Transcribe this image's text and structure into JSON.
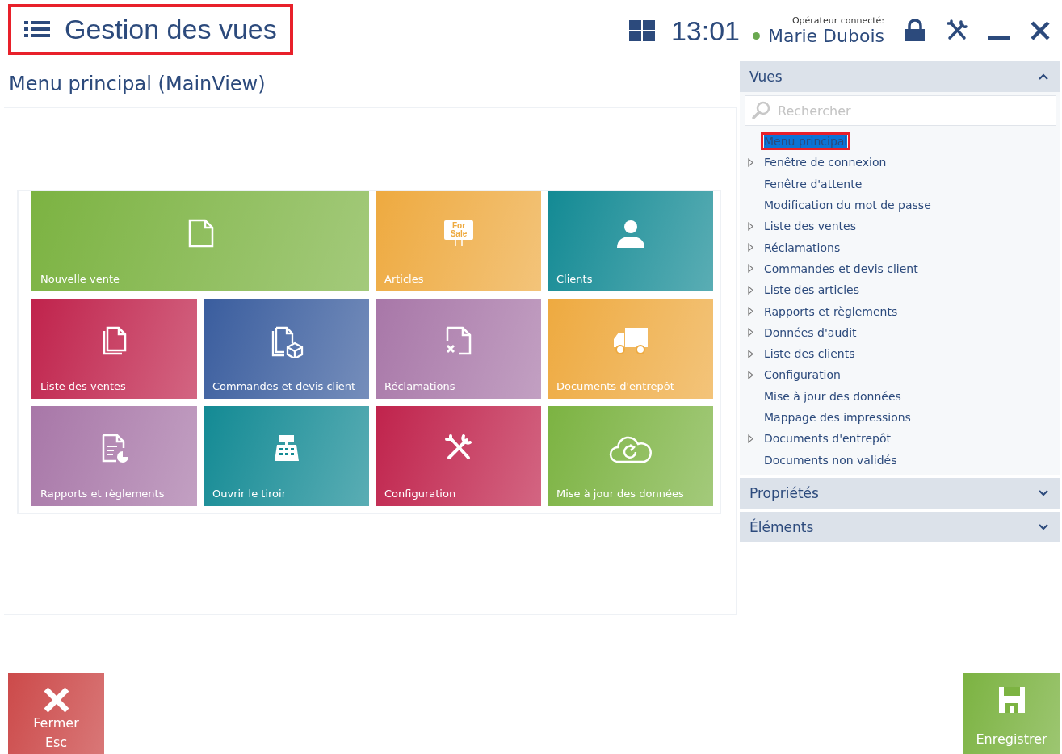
{
  "header": {
    "title": "Gestion des vues",
    "title_highlighted": true,
    "time": "13:01",
    "operator_label": "Opérateur connecté:",
    "operator_name": "Marie Dubois"
  },
  "main": {
    "title": "Menu principal (MainView)",
    "tiles": [
      {
        "label": "Nouvelle vente",
        "kind": "document",
        "color": "#7cb342",
        "wide": true
      },
      {
        "label": "Articles",
        "kind": "sign",
        "color": "#eeaa40",
        "wide": false,
        "sign_text": [
          "For",
          "Sale"
        ]
      },
      {
        "label": "Clients",
        "kind": "person",
        "color": "#138a94",
        "wide": false
      },
      {
        "label": "Liste des ventes",
        "kind": "documents",
        "color": "#c0234c",
        "wide": false
      },
      {
        "label": "Commandes et devis client",
        "kind": "documents-box",
        "color": "#3a5d9e",
        "wide": false
      },
      {
        "label": "Réclamations",
        "kind": "document-x",
        "color": "#a877a8",
        "wide": false
      },
      {
        "label": "Documents d'entrepôt",
        "kind": "truck",
        "color": "#eeaa40",
        "wide": false
      },
      {
        "label": "Rapports et règlements",
        "kind": "report",
        "color": "#a877a8",
        "wide": false
      },
      {
        "label": "Ouvrir le tiroir",
        "kind": "register",
        "color": "#138a94",
        "wide": false
      },
      {
        "label": "Configuration",
        "kind": "tools",
        "color": "#c0234c",
        "wide": false
      },
      {
        "label": "Mise à jour des données",
        "kind": "cloud",
        "color": "#7cb342",
        "wide": false
      }
    ]
  },
  "side": {
    "sections": [
      {
        "title": "Vues",
        "expanded": true,
        "search": {
          "placeholder": "Rechercher"
        },
        "tree": [
          {
            "label": "Menu principal",
            "expandable": false,
            "selected": true,
            "highlighted": true
          },
          {
            "label": "Fenêtre de connexion",
            "expandable": true,
            "selected": false,
            "highlighted": false
          },
          {
            "label": "Fenêtre d'attente",
            "expandable": false,
            "selected": false,
            "highlighted": false
          },
          {
            "label": "Modification du mot de passe",
            "expandable": false,
            "selected": false,
            "highlighted": false
          },
          {
            "label": "Liste des ventes",
            "expandable": true,
            "selected": false,
            "highlighted": false
          },
          {
            "label": "Réclamations",
            "expandable": true,
            "selected": false,
            "highlighted": false
          },
          {
            "label": "Commandes et devis client",
            "expandable": true,
            "selected": false,
            "highlighted": false
          },
          {
            "label": "Liste des articles",
            "expandable": true,
            "selected": false,
            "highlighted": false
          },
          {
            "label": "Rapports et règlements",
            "expandable": true,
            "selected": false,
            "highlighted": false
          },
          {
            "label": "Données d'audit",
            "expandable": true,
            "selected": false,
            "highlighted": false
          },
          {
            "label": "Liste des clients",
            "expandable": true,
            "selected": false,
            "highlighted": false
          },
          {
            "label": "Configuration",
            "expandable": true,
            "selected": false,
            "highlighted": false
          },
          {
            "label": "Mise à jour des données",
            "expandable": false,
            "selected": false,
            "highlighted": false
          },
          {
            "label": "Mappage des impressions",
            "expandable": false,
            "selected": false,
            "highlighted": false
          },
          {
            "label": "Documents d'entrepôt",
            "expandable": true,
            "selected": false,
            "highlighted": false
          },
          {
            "label": "Documents non validés",
            "expandable": false,
            "selected": false,
            "highlighted": false
          }
        ]
      },
      {
        "title": "Propriétés",
        "expanded": false
      },
      {
        "title": "Éléments",
        "expanded": false
      }
    ]
  },
  "footer": {
    "buttons": [
      {
        "kind": "close",
        "labels": [
          "Fermer",
          "Esc"
        ]
      },
      {
        "kind": "save",
        "labels": [
          "Enregistrer"
        ]
      }
    ]
  }
}
